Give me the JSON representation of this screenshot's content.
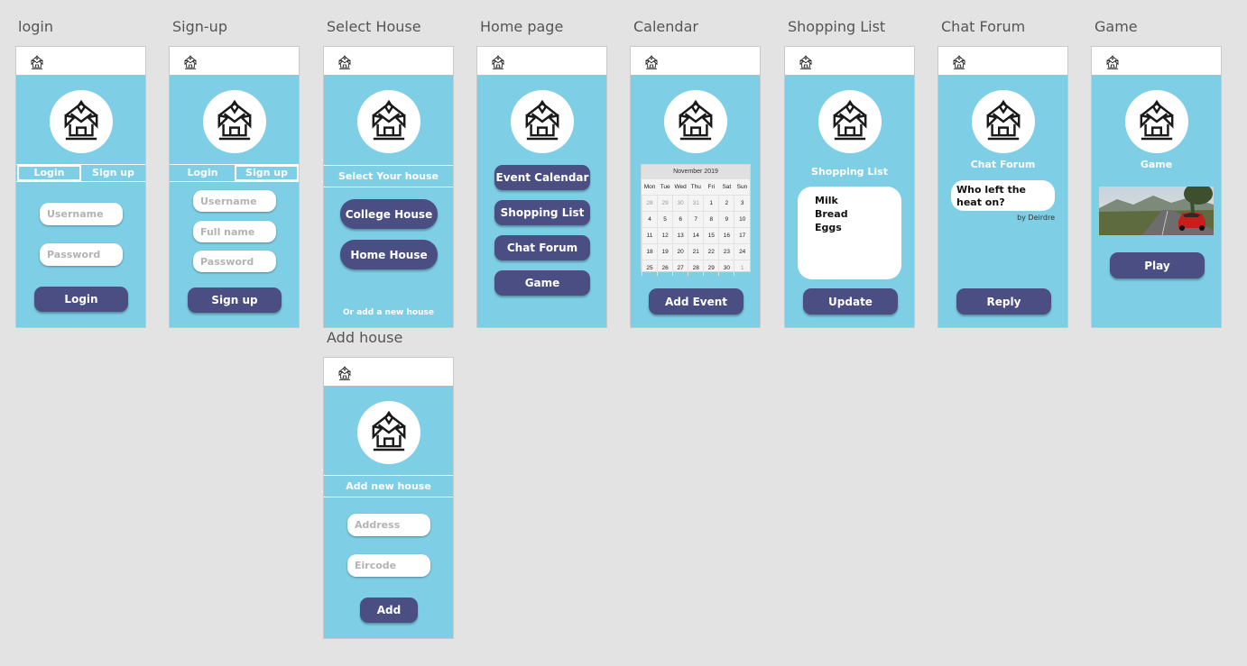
{
  "titles": {
    "login": "login",
    "signup": "Sign-up",
    "select_house": "Select House",
    "home_page": "Home page",
    "calendar": "Calendar",
    "shopping_list": "Shopping List",
    "chat_forum": "Chat Forum",
    "game": "Game",
    "add_house": "Add house"
  },
  "colors": {
    "background": "#e3e3e3",
    "screen": "#7ecfe6",
    "button": "#4a4e83",
    "white": "#ffffff"
  },
  "icons": {
    "app_icon": "house-icon",
    "logo": "house-logo-icon"
  },
  "login": {
    "tab_login": "Login",
    "tab_signup": "Sign up",
    "username_placeholder": "Username",
    "password_placeholder": "Password",
    "button": "Login"
  },
  "signup": {
    "tab_login": "Login",
    "tab_signup": "Sign up",
    "username_placeholder": "Username",
    "fullname_placeholder": "Full name",
    "password_placeholder": "Password",
    "button": "Sign up"
  },
  "select_house": {
    "header": "Select Your house",
    "college_button": "College House",
    "home_button": "Home House",
    "add_link": "Or add a new house"
  },
  "home_page": {
    "event_calendar": "Event Calendar",
    "shopping_list": "Shopping List",
    "chat_forum": "Chat Forum",
    "game": "Game"
  },
  "calendar": {
    "month": "November 2019",
    "weekdays": [
      "Mon",
      "Tue",
      "Wed",
      "Thu",
      "Fri",
      "Sat",
      "Sun"
    ],
    "weeks": [
      [
        "28",
        "29",
        "30",
        "31",
        "1",
        "2",
        "3"
      ],
      [
        "4",
        "5",
        "6",
        "7",
        "8",
        "9",
        "10"
      ],
      [
        "11",
        "12",
        "13",
        "14",
        "15",
        "16",
        "17"
      ],
      [
        "18",
        "19",
        "20",
        "21",
        "22",
        "23",
        "24"
      ],
      [
        "25",
        "26",
        "27",
        "28",
        "29",
        "30",
        "1"
      ]
    ],
    "button": "Add Event"
  },
  "shopping_list": {
    "heading": "Shopping List",
    "items": [
      "Milk",
      "Bread",
      "Eggs"
    ],
    "button": "Update"
  },
  "chat_forum": {
    "heading": "Chat Forum",
    "message": "Who left the heat on?",
    "author": "by Deirdre",
    "button": "Reply"
  },
  "game": {
    "heading": "Game",
    "button": "Play"
  },
  "add_house": {
    "header": "Add new house",
    "address_placeholder": "Address",
    "eircode_placeholder": "Eircode",
    "button": "Add"
  }
}
